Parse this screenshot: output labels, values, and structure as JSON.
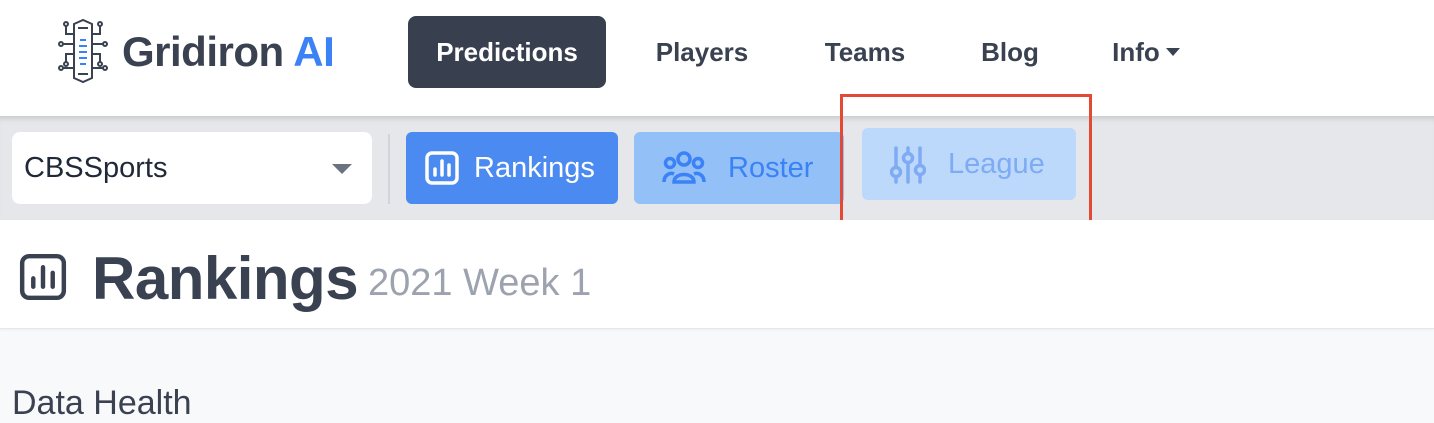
{
  "brand": {
    "name_part1": "Gridiron",
    "name_part2": "AI"
  },
  "nav": {
    "items": [
      {
        "label": "Predictions",
        "active": true
      },
      {
        "label": "Players"
      },
      {
        "label": "Teams"
      },
      {
        "label": "Blog"
      },
      {
        "label": "Info",
        "has_dropdown": true
      }
    ]
  },
  "toolbar": {
    "source_select": {
      "value": "CBSSports"
    },
    "buttons": [
      {
        "label": "Rankings",
        "icon": "chart-bar-icon"
      },
      {
        "label": "Roster",
        "icon": "users-icon"
      },
      {
        "label": "League",
        "icon": "sliders-icon"
      }
    ]
  },
  "page": {
    "title": "Rankings",
    "subtitle": "2021 Week 1",
    "section_title": "Data Health"
  },
  "colors": {
    "accent": "#3b82f6",
    "nav_active_bg": "#383f4e",
    "rankings_bg": "#4b8af0",
    "roster_bg": "#93c0f7",
    "league_bg": "#bcd8fb",
    "highlight": "#e24a33"
  }
}
